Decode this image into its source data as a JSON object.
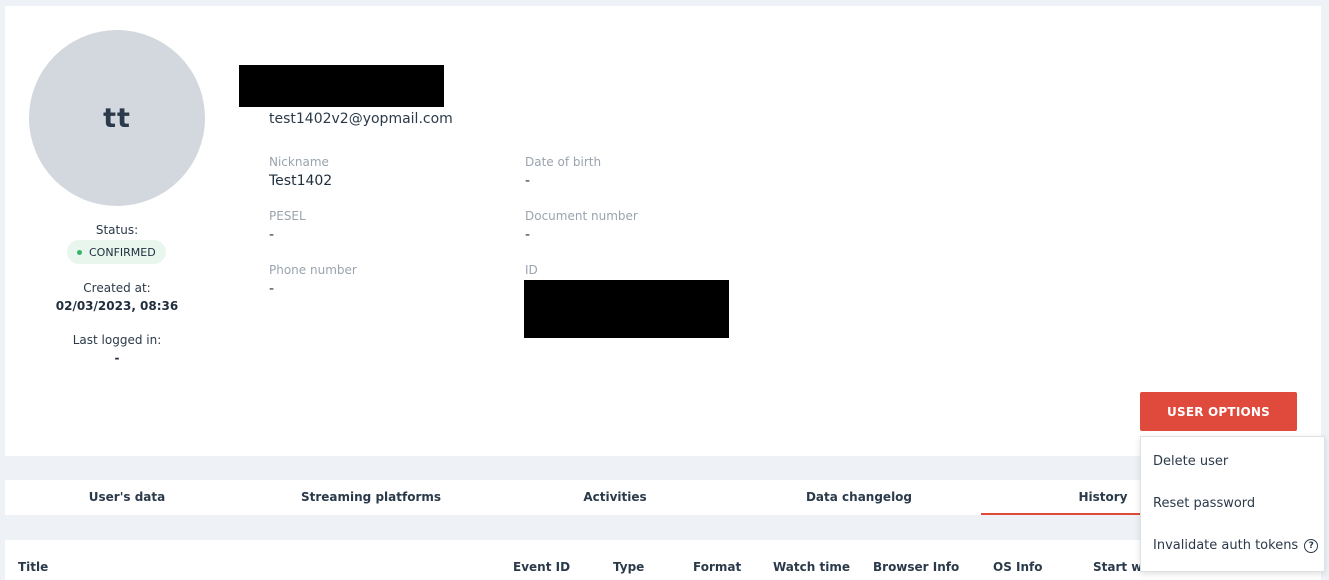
{
  "profile": {
    "avatar_initials": "tt",
    "status_label": "Status:",
    "status_value": "CONFIRMED",
    "created_label": "Created at:",
    "created_value": "02/03/2023, 08:36",
    "last_login_label": "Last logged in:",
    "last_login_value": "-",
    "email": "test1402v2@yopmail.com"
  },
  "fields": {
    "nickname": {
      "label": "Nickname",
      "value": "Test1402"
    },
    "dob": {
      "label": "Date of birth",
      "value": "-"
    },
    "pesel": {
      "label": "PESEL",
      "value": "-"
    },
    "document": {
      "label": "Document number",
      "value": "-"
    },
    "phone": {
      "label": "Phone number",
      "value": "-"
    },
    "id": {
      "label": "ID"
    }
  },
  "user_options": {
    "button_label": "USER OPTIONS",
    "menu": [
      "Delete user",
      "Reset password",
      "Invalidate auth tokens"
    ],
    "help_icon": "question-circle-icon"
  },
  "tabs": [
    "User's data",
    "Streaming platforms",
    "Activities",
    "Data changelog",
    "History"
  ],
  "active_tab": "History",
  "table": {
    "columns": [
      "Title",
      "Event ID",
      "Type",
      "Format",
      "Watch time",
      "Browser Info",
      "OS Info",
      "Start wa"
    ]
  },
  "colors": {
    "accent": "#e04a3c",
    "status_dot": "#35b56a",
    "avatar_bg": "#d3d8de"
  }
}
